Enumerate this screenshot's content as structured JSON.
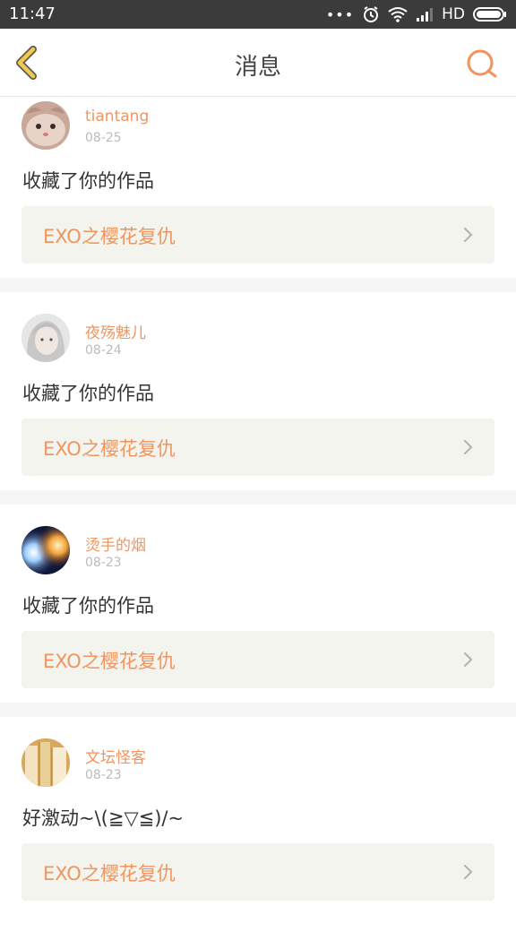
{
  "status": {
    "time": "11:47",
    "dots": "•••",
    "network": "HD"
  },
  "header": {
    "title": "消息",
    "back_icon": "chevron-left-icon",
    "search_icon": "search-icon"
  },
  "colors": {
    "accent": "#f0955e",
    "back_accent": "#f2c94c"
  },
  "messages": [
    {
      "user": "tiantang",
      "date": "08-25",
      "content": "收藏了你的作品",
      "work": "EXO之樱花复仇"
    },
    {
      "user": "夜殇魅儿",
      "date": "08-24",
      "content": "收藏了你的作品",
      "work": "EXO之樱花复仇"
    },
    {
      "user": "烫手的烟",
      "date": "08-23",
      "content": "收藏了你的作品",
      "work": "EXO之樱花复仇"
    },
    {
      "user": "文坛怪客",
      "date": "08-23",
      "content": "好激动~\\(≧▽≦)/~",
      "work": "EXO之樱花复仇"
    }
  ]
}
